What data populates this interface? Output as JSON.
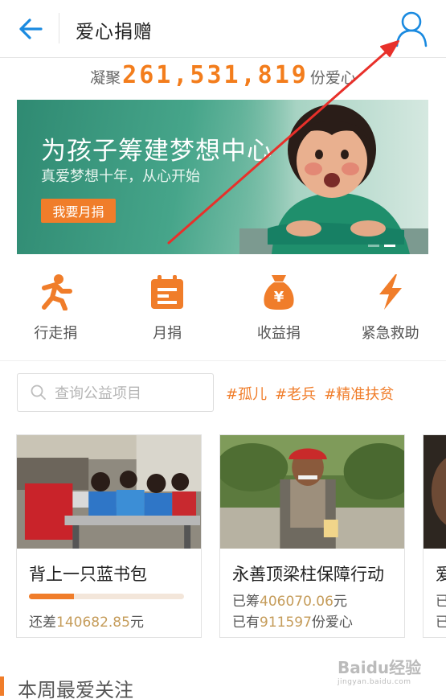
{
  "header": {
    "title": "爱心捐赠",
    "back_icon": "arrow-left-icon",
    "user_icon": "user-icon"
  },
  "counter": {
    "prefix": "凝聚",
    "number": "261,531,819",
    "suffix": "份爱心"
  },
  "banner": {
    "title": "为孩子筹建梦想中心",
    "subtitle": "真爱梦想十年，从心开始",
    "button": "我要月捐",
    "slides": 2,
    "active_slide": 2
  },
  "categories": [
    {
      "label": "行走捐",
      "icon": "walking-person-icon"
    },
    {
      "label": "月捐",
      "icon": "calendar-icon"
    },
    {
      "label": "收益捐",
      "icon": "money-bag-icon"
    },
    {
      "label": "紧急救助",
      "icon": "lightning-icon"
    }
  ],
  "search": {
    "placeholder": "查询公益项目",
    "icon": "search-icon"
  },
  "tags": [
    "#孤儿",
    "#老兵",
    "#精准扶贫"
  ],
  "projects": [
    {
      "title": "背上一只蓝书包",
      "progress_percent": 29,
      "remaining_label": "还差",
      "remaining_value": "140682.85",
      "remaining_unit": "元"
    },
    {
      "title": "永善顶梁柱保障行动",
      "raised_label": "已筹",
      "raised_value": "406070.06",
      "raised_unit": "元",
      "hearts_label": "已有",
      "hearts_value": "911597",
      "hearts_unit": "份爱心"
    },
    {
      "title": "爱",
      "line1": "已",
      "line2": "已"
    }
  ],
  "section": {
    "title": "本周最爱关注"
  },
  "watermark": {
    "brand": "Baidu经验",
    "url": "jingyan.baidu.com"
  },
  "colors": {
    "accent": "#f07d2a",
    "counter": "#f37d1c",
    "header_icons": "#1a8ae0",
    "annotation": "#e8302a"
  }
}
